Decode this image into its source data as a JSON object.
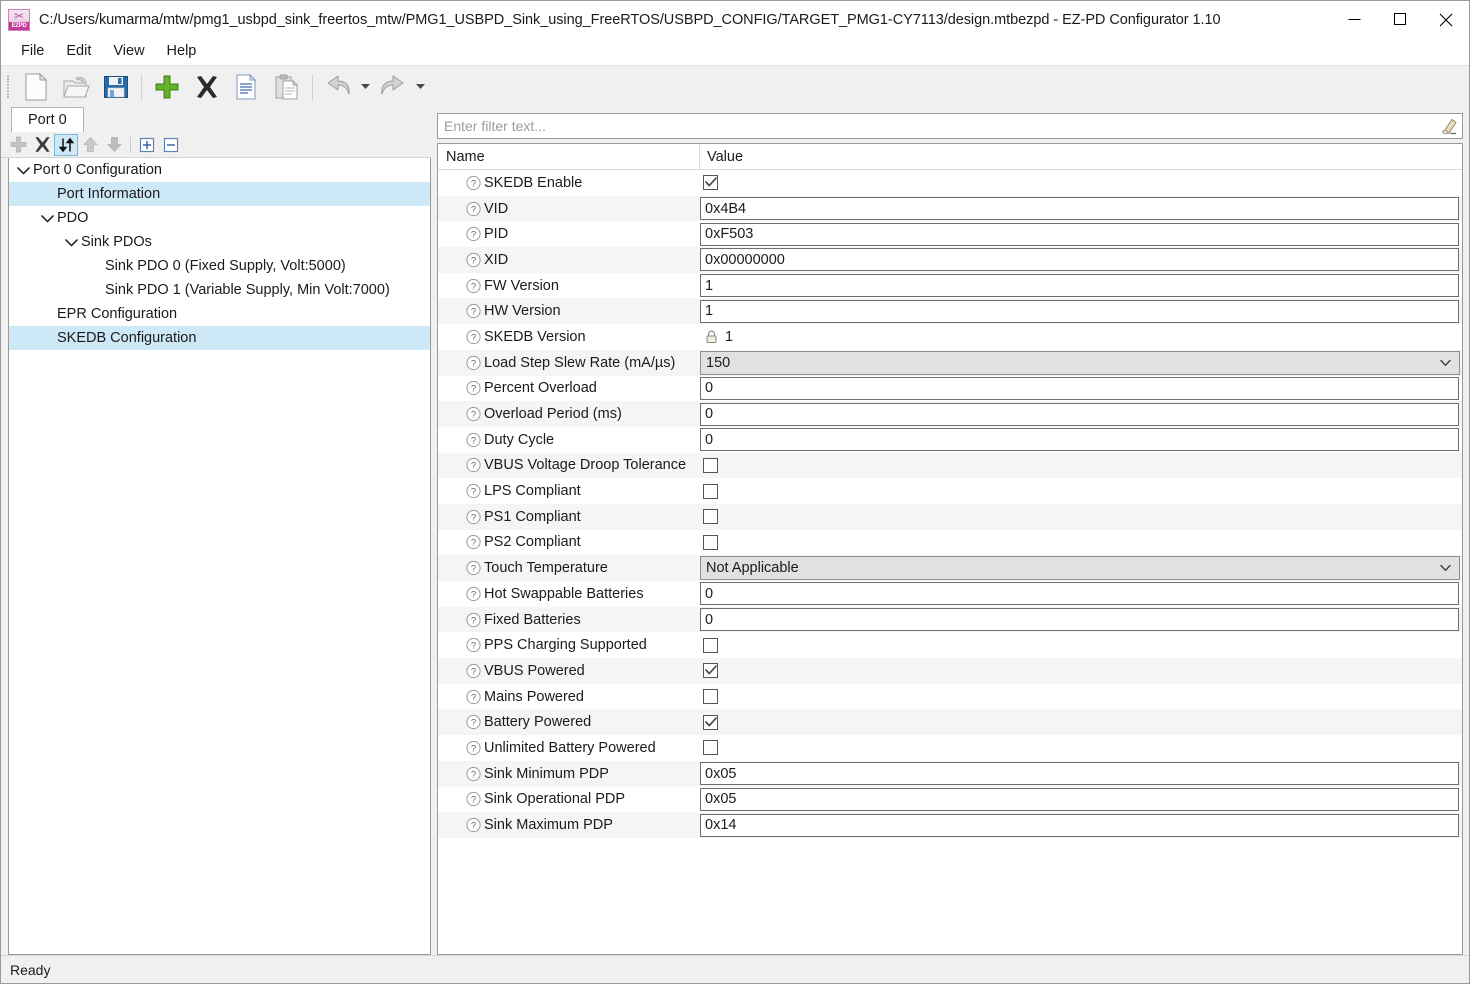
{
  "window": {
    "title": "C:/Users/kumarma/mtw/pmg1_usbpd_sink_freertos_mtw/PMG1_USBPD_Sink_using_FreeRTOS/USBPD_CONFIG/TARGET_PMG1-CY7113/design.mtbezpd - EZ-PD Configurator 1.10",
    "app_icon": "ezpd-app-icon",
    "icon_label": "EZPD",
    "controls": [
      {
        "name": "minimize-button",
        "glyph": "minimize-icon"
      },
      {
        "name": "maximize-button",
        "glyph": "maximize-icon"
      },
      {
        "name": "close-button",
        "glyph": "close-icon"
      }
    ]
  },
  "menubar": {
    "items": [
      {
        "label": "File"
      },
      {
        "label": "Edit"
      },
      {
        "label": "View"
      },
      {
        "label": "Help"
      }
    ]
  },
  "toolbar": {
    "buttons": [
      {
        "name": "new-file-button",
        "icon": "new-file-icon",
        "enabled": true
      },
      {
        "name": "open-file-button",
        "icon": "open-folder-icon",
        "enabled": true
      },
      {
        "name": "save-button",
        "icon": "save-floppy-icon",
        "enabled": true
      },
      {
        "name": "add-button",
        "icon": "plus-icon",
        "enabled": true
      },
      {
        "name": "delete-button",
        "icon": "x-delete-icon",
        "enabled": true
      },
      {
        "name": "copy-button",
        "icon": "copy-icon",
        "enabled": true
      },
      {
        "name": "paste-button",
        "icon": "paste-icon",
        "enabled": true
      },
      {
        "name": "undo-button",
        "icon": "undo-arrow-icon",
        "enabled": true
      },
      {
        "name": "redo-button",
        "icon": "redo-arrow-icon",
        "enabled": true
      }
    ]
  },
  "tabs": [
    {
      "label": "Port 0",
      "active": true
    }
  ],
  "tree_toolbar": {
    "buttons": [
      {
        "name": "tree-add-button",
        "icon": "plus-icon",
        "state": "disabled"
      },
      {
        "name": "tree-delete-button",
        "icon": "x-delete-icon",
        "state": "enabled"
      },
      {
        "name": "tree-sort-toggle-button",
        "icon": "sort-updown-icon",
        "state": "active"
      },
      {
        "name": "tree-move-up-button",
        "icon": "arrow-up-icon",
        "state": "disabled"
      },
      {
        "name": "tree-move-down-button",
        "icon": "arrow-down-icon",
        "state": "disabled"
      },
      {
        "name": "tree-expand-all-button",
        "icon": "expand-all-icon",
        "state": "enabled"
      },
      {
        "name": "tree-collapse-all-button",
        "icon": "collapse-all-icon",
        "state": "enabled"
      }
    ]
  },
  "tree": {
    "items": [
      {
        "label": "Port 0 Configuration",
        "depth": 0,
        "expander": "expanded",
        "selected": false
      },
      {
        "label": "Port Information",
        "depth": 1,
        "expander": "none",
        "selected": true
      },
      {
        "label": "PDO",
        "depth": 1,
        "expander": "expanded",
        "selected": false
      },
      {
        "label": "Sink PDOs",
        "depth": 2,
        "expander": "expanded",
        "selected": false
      },
      {
        "label": "Sink PDO 0 (Fixed Supply, Volt:5000)",
        "depth": 3,
        "expander": "none",
        "selected": false
      },
      {
        "label": "Sink PDO 1 (Variable Supply, Min Volt:7000)",
        "depth": 3,
        "expander": "none",
        "selected": false
      },
      {
        "label": "EPR Configuration",
        "depth": 1,
        "expander": "none",
        "selected": false
      },
      {
        "label": "SKEDB Configuration",
        "depth": 1,
        "expander": "none",
        "selected": true
      }
    ]
  },
  "filter": {
    "value": "",
    "placeholder": "Enter filter text...",
    "clear_icon": "eraser-icon"
  },
  "properties": {
    "columns": {
      "name": "Name",
      "value": "Value"
    },
    "rows": [
      {
        "name": "SKEDB Enable",
        "kind": "checkbox",
        "checked": true,
        "value": ""
      },
      {
        "name": "VID",
        "kind": "text",
        "value": "0x4B4"
      },
      {
        "name": "PID",
        "kind": "text",
        "value": "0xF503"
      },
      {
        "name": "XID",
        "kind": "text",
        "value": "0x00000000"
      },
      {
        "name": "FW Version",
        "kind": "text",
        "value": "1"
      },
      {
        "name": "HW Version",
        "kind": "text",
        "value": "1"
      },
      {
        "name": "SKEDB Version",
        "kind": "locked",
        "value": "1"
      },
      {
        "name": "Load Step Slew Rate (mA/µs)",
        "kind": "combo",
        "value": "150"
      },
      {
        "name": "Percent Overload",
        "kind": "text",
        "value": "0"
      },
      {
        "name": "Overload Period (ms)",
        "kind": "text",
        "value": "0"
      },
      {
        "name": "Duty Cycle",
        "kind": "text",
        "value": "0"
      },
      {
        "name": "VBUS Voltage Droop Tolerance",
        "kind": "checkbox",
        "checked": false,
        "value": ""
      },
      {
        "name": "LPS Compliant",
        "kind": "checkbox",
        "checked": false,
        "value": ""
      },
      {
        "name": "PS1 Compliant",
        "kind": "checkbox",
        "checked": false,
        "value": ""
      },
      {
        "name": "PS2 Compliant",
        "kind": "checkbox",
        "checked": false,
        "value": ""
      },
      {
        "name": "Touch Temperature",
        "kind": "combo",
        "value": "Not Applicable"
      },
      {
        "name": "Hot Swappable Batteries",
        "kind": "text",
        "value": "0"
      },
      {
        "name": "Fixed Batteries",
        "kind": "text",
        "value": "0"
      },
      {
        "name": "PPS Charging Supported",
        "kind": "checkbox",
        "checked": false,
        "value": ""
      },
      {
        "name": "VBUS Powered",
        "kind": "checkbox",
        "checked": true,
        "value": ""
      },
      {
        "name": "Mains Powered",
        "kind": "checkbox",
        "checked": false,
        "value": ""
      },
      {
        "name": "Battery Powered",
        "kind": "checkbox",
        "checked": true,
        "value": ""
      },
      {
        "name": "Unlimited Battery Powered",
        "kind": "checkbox",
        "checked": false,
        "value": ""
      },
      {
        "name": "Sink Minimum PDP",
        "kind": "text",
        "value": "0x05"
      },
      {
        "name": "Sink Operational PDP",
        "kind": "text",
        "value": "0x05"
      },
      {
        "name": "Sink Maximum PDP",
        "kind": "text",
        "value": "0x14"
      }
    ],
    "help_icon": "question-mark-icon"
  },
  "statusbar": {
    "text": "Ready"
  },
  "colors": {
    "selection": "#cde8f6",
    "window_bg": "#f0f0f0",
    "row_alt": "#f5f5f5",
    "accent_green": "#5aa32b",
    "brand_pink": "#c23c9a"
  }
}
